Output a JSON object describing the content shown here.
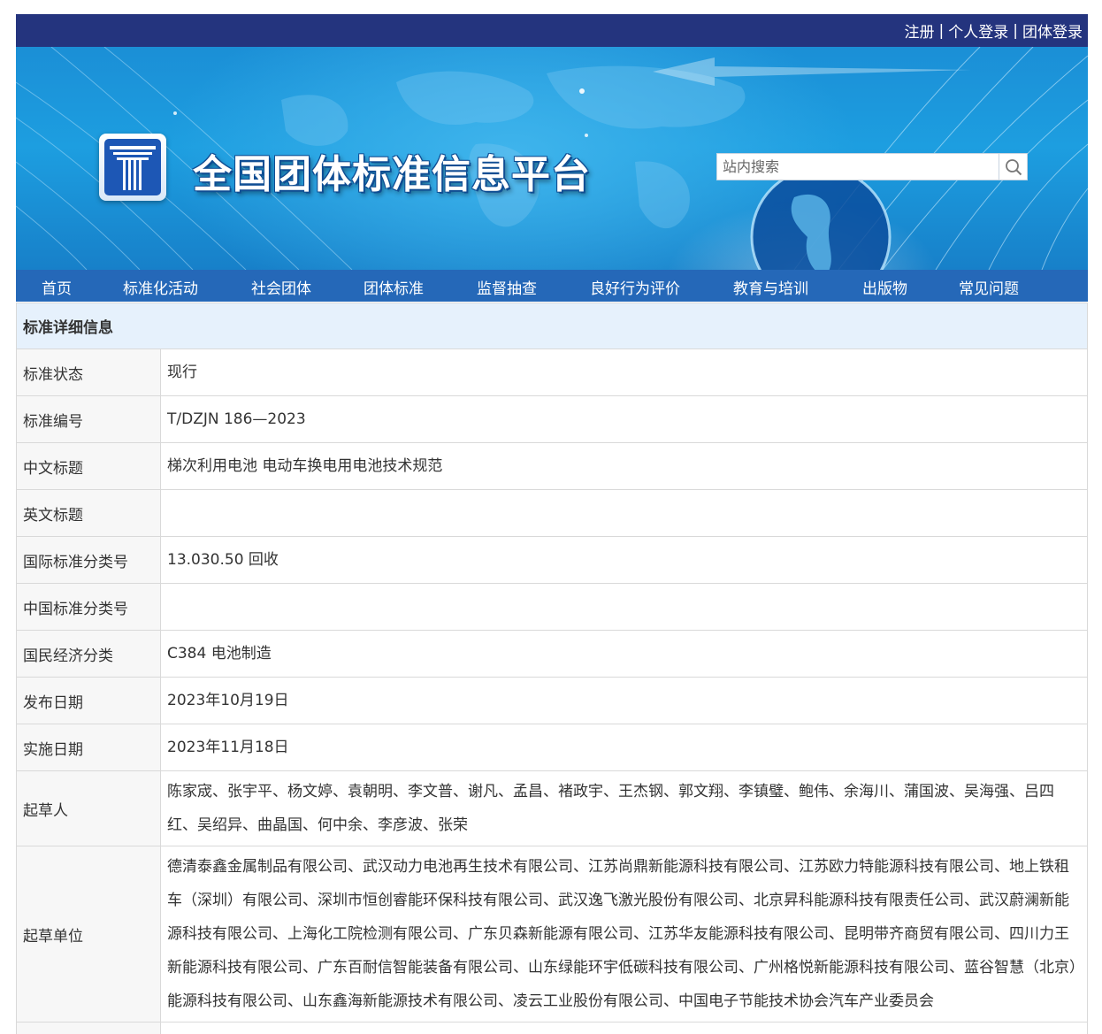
{
  "top_links": [
    "注册",
    "个人登录",
    "团体登录"
  ],
  "top_sep": "|",
  "site_title": "全国团体标准信息平台",
  "search": {
    "placeholder": "站内搜索"
  },
  "nav": [
    "首页",
    "标准化活动",
    "社会团体",
    "团体标准",
    "监督抽查",
    "良好行为评价",
    "教育与培训",
    "出版物",
    "常见问题"
  ],
  "section_title": "标准详细信息",
  "rows": [
    {
      "label": "标准状态",
      "value": "现行"
    },
    {
      "label": "标准编号",
      "value": "T/DZJN 186—2023"
    },
    {
      "label": "中文标题",
      "value": "梯次利用电池 电动车换电用电池技术规范"
    },
    {
      "label": "英文标题",
      "value": ""
    },
    {
      "label": "国际标准分类号",
      "value": "13.030.50 回收"
    },
    {
      "label": "中国标准分类号",
      "value": ""
    },
    {
      "label": "国民经济分类",
      "value": "C384 电池制造"
    },
    {
      "label": "发布日期",
      "value": "2023年10月19日"
    },
    {
      "label": "实施日期",
      "value": "2023年11月18日"
    },
    {
      "label": "起草人",
      "value": "陈家宬、张宇平、杨文婷、袁朝明、李文普、谢凡、孟昌、褚政宇、王杰钢、郭文翔、李镇璧、鲍伟、余海川、蒲国波、吴海强、吕四红、吴绍异、曲晶国、何中余、李彦波、张荣"
    },
    {
      "label": "起草单位",
      "value": "德清泰鑫金属制品有限公司、武汉动力电池再生技术有限公司、江苏尚鼎新能源科技有限公司、江苏欧力特能源科技有限公司、地上铁租车（深圳）有限公司、深圳市恒创睿能环保科技有限公司、武汉逸飞激光股份有限公司、北京昇科能源科技有限责任公司、武汉蔚澜新能源科技有限公司、上海化工院检测有限公司、广东贝森新能源有限公司、江苏华友能源科技有限公司、昆明带齐商贸有限公司、四川力王新能源科技有限公司、广东百耐信智能装备有限公司、山东绿能环宇低碳科技有限公司、广州格悦新能源科技有限公司、蓝谷智慧（北京）能源科技有限公司、山东鑫海新能源技术有限公司、凌云工业股份有限公司、中国电子节能技术协会汽车产业委员会"
    }
  ],
  "colors": {
    "topbar": "#24347e",
    "nav": "#2568b8",
    "header_bg": "#e6f1fc",
    "label_bg": "#f7f7f7"
  }
}
